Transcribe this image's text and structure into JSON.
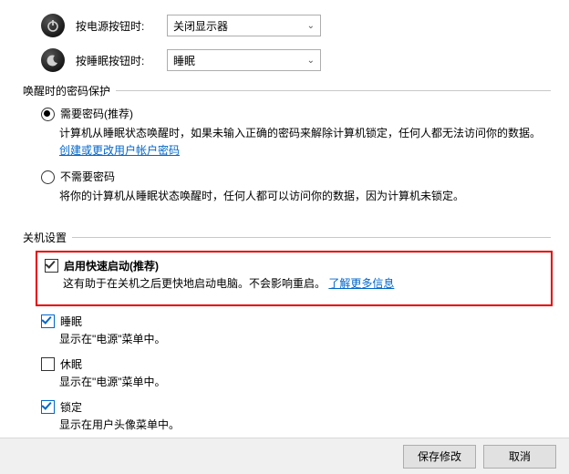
{
  "power": {
    "row1": {
      "label": "按电源按钮时:",
      "value": "关闭显示器"
    },
    "row2": {
      "label": "按睡眠按钮时:",
      "value": "睡眠"
    }
  },
  "wake": {
    "title": "唤醒时的密码保护",
    "opt1": {
      "label": "需要密码(推荐)",
      "desc_a": "计算机从睡眠状态唤醒时，如果未输入正确的密码来解除计算机锁定，任何人都无法访问你的数据。",
      "link": "创建或更改用户帐户密码"
    },
    "opt2": {
      "label": "不需要密码",
      "desc": "将你的计算机从睡眠状态唤醒时，任何人都可以访问你的数据，因为计算机未锁定。"
    }
  },
  "shutdown": {
    "title": "关机设置",
    "fast": {
      "label": "启用快速启动(推荐)",
      "desc": "这有助于在关机之后更快地启动电脑。不会影响重启。",
      "link": "了解更多信息"
    },
    "sleep": {
      "label": "睡眠",
      "desc": "显示在\"电源\"菜单中。"
    },
    "hiber": {
      "label": "休眠",
      "desc": "显示在\"电源\"菜单中。"
    },
    "lock": {
      "label": "锁定",
      "desc": "显示在用户头像菜单中。"
    }
  },
  "buttons": {
    "save": "保存修改",
    "cancel": "取消"
  }
}
